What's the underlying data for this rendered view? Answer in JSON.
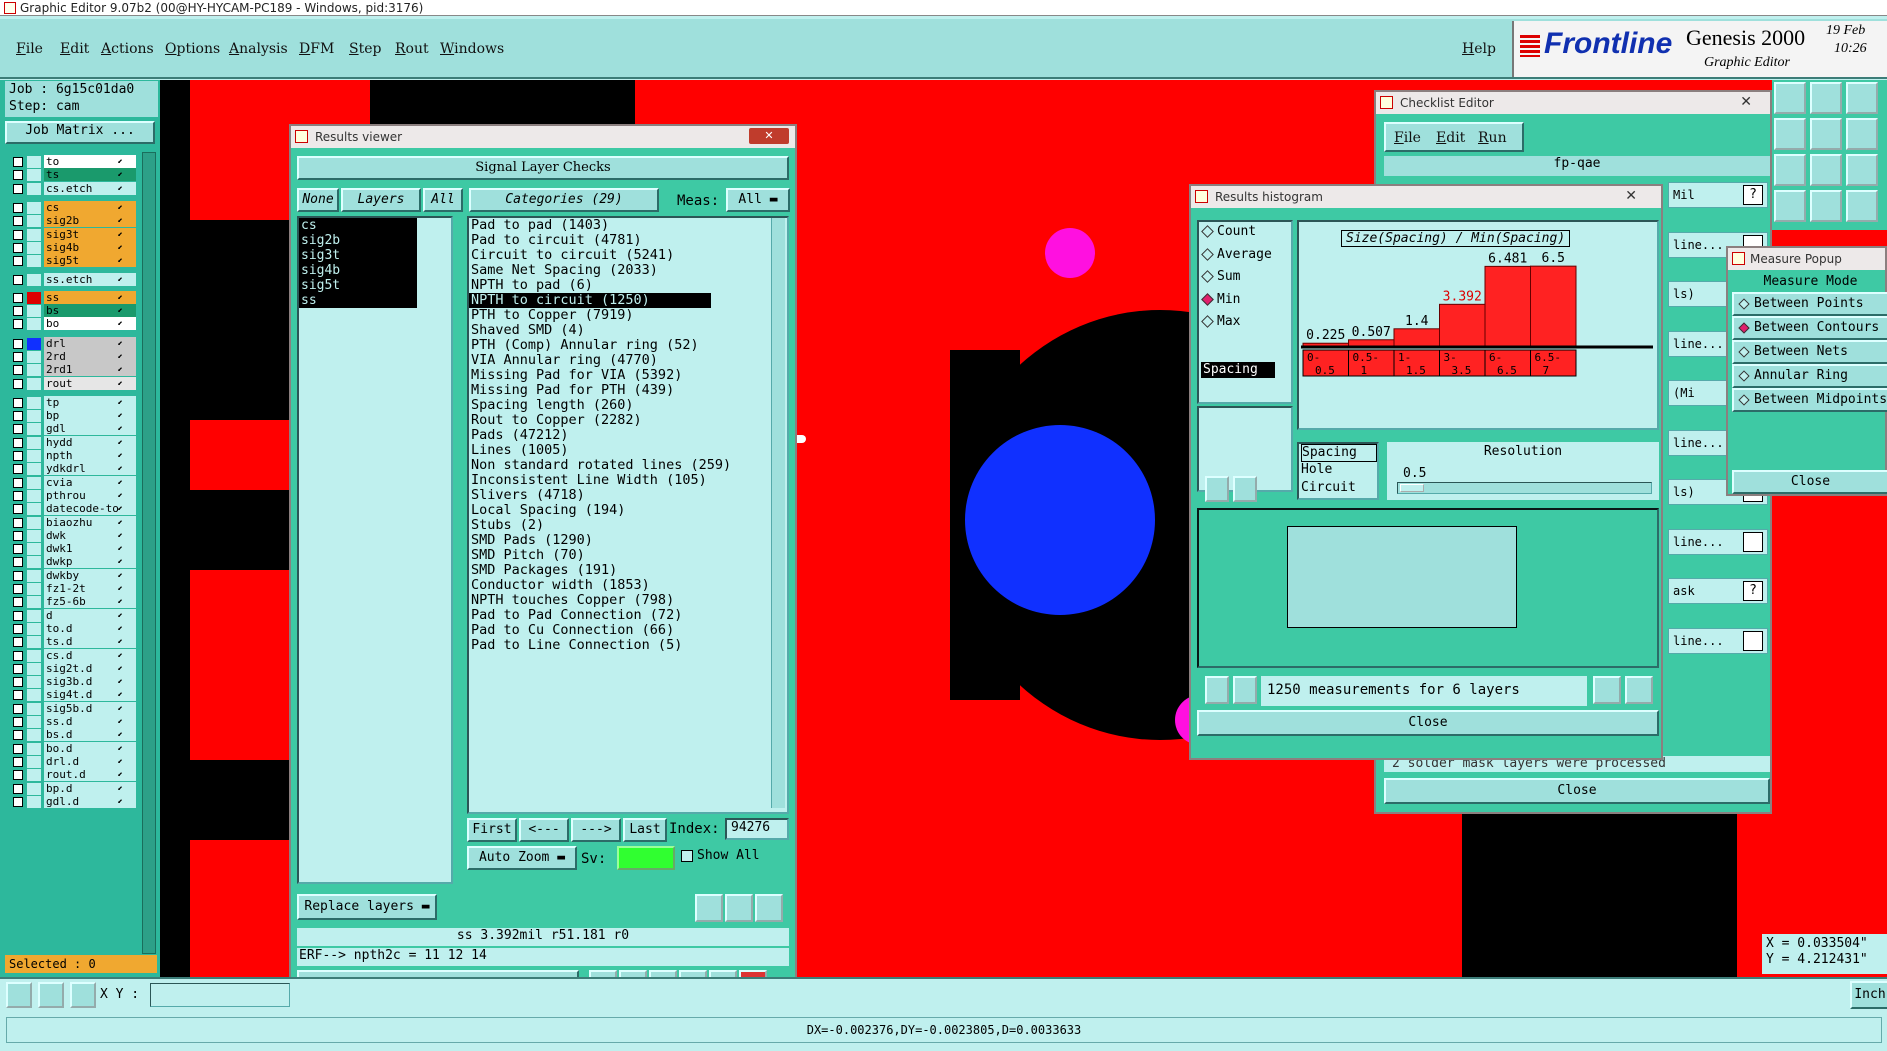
{
  "window_title": "Graphic Editor 9.07b2 (00@HY-HYCAM-PC189 - Windows, pid:3176)",
  "menu": [
    "File",
    "Edit",
    "Actions",
    "Options",
    "Analysis",
    "DFM",
    "Step",
    "Rout",
    "Windows"
  ],
  "help": "Help",
  "brand": {
    "logo": "Frontline",
    "product": "Genesis 2000",
    "subtitle": "Graphic Editor",
    "date": "19 Feb",
    "time": "10:26"
  },
  "job": {
    "job": "Job : 6g15c01da0",
    "step": "Step: cam",
    "matrix_button": "Job Matrix ..."
  },
  "layers": [
    {
      "name": "to",
      "color": "#ffffff"
    },
    {
      "name": "ts",
      "color": "#1a9a6c"
    },
    {
      "name": "cs.etch",
      "color": "#bff0ee"
    },
    {
      "name": "cs",
      "color": "#f0a830"
    },
    {
      "name": "sig2b",
      "color": "#f0a830"
    },
    {
      "name": "sig3t",
      "color": "#f0a830"
    },
    {
      "name": "sig4b",
      "color": "#f0a830"
    },
    {
      "name": "sig5t",
      "color": "#f0a830"
    },
    {
      "name": "ss.etch",
      "color": "#bff0ee"
    },
    {
      "name": "ss",
      "color": "#f0a830"
    },
    {
      "name": "bs",
      "color": "#1a9a6c"
    },
    {
      "name": "bo",
      "color": "#ffffff"
    },
    {
      "name": "drl",
      "color": "#c8c8c8"
    },
    {
      "name": "2rd",
      "color": "#c8c8c8"
    },
    {
      "name": "2rd1",
      "color": "#c8c8c8"
    },
    {
      "name": "rout",
      "color": "#e6e6e6"
    },
    {
      "name": "tp",
      "color": "#bff0ee"
    },
    {
      "name": "bp",
      "color": "#bff0ee"
    },
    {
      "name": "gdl",
      "color": "#bff0ee"
    },
    {
      "name": "hydd",
      "color": "#bff0ee"
    },
    {
      "name": "npth",
      "color": "#bff0ee"
    },
    {
      "name": "ydkdrl",
      "color": "#bff0ee"
    },
    {
      "name": "cvia",
      "color": "#bff0ee"
    },
    {
      "name": "pthrou",
      "color": "#bff0ee"
    },
    {
      "name": "datecode-to",
      "color": "#bff0ee"
    },
    {
      "name": "biaozhu",
      "color": "#bff0ee"
    },
    {
      "name": "dwk",
      "color": "#bff0ee"
    },
    {
      "name": "dwk1",
      "color": "#bff0ee"
    },
    {
      "name": "dwkp",
      "color": "#bff0ee"
    },
    {
      "name": "dwkby",
      "color": "#bff0ee"
    },
    {
      "name": "fz1-2t",
      "color": "#bff0ee"
    },
    {
      "name": "fz5-6b",
      "color": "#bff0ee"
    },
    {
      "name": "d",
      "color": "#bff0ee"
    },
    {
      "name": "to.d",
      "color": "#bff0ee"
    },
    {
      "name": "ts.d",
      "color": "#bff0ee"
    },
    {
      "name": "cs.d",
      "color": "#bff0ee"
    },
    {
      "name": "sig2t.d",
      "color": "#bff0ee"
    },
    {
      "name": "sig3b.d",
      "color": "#bff0ee"
    },
    {
      "name": "sig4t.d",
      "color": "#bff0ee"
    },
    {
      "name": "sig5b.d",
      "color": "#bff0ee"
    },
    {
      "name": "ss.d",
      "color": "#bff0ee"
    },
    {
      "name": "bs.d",
      "color": "#bff0ee"
    },
    {
      "name": "bo.d",
      "color": "#bff0ee"
    },
    {
      "name": "drl.d",
      "color": "#bff0ee"
    },
    {
      "name": "rout.d",
      "color": "#bff0ee"
    },
    {
      "name": "bp.d",
      "color": "#bff0ee"
    },
    {
      "name": "gdl.d",
      "color": "#bff0ee"
    }
  ],
  "selected": "Selected : 0",
  "results_viewer": {
    "title": "Results viewer",
    "header": "Signal Layer Checks",
    "none": "None",
    "layers_tab": "Layers",
    "all": "All",
    "categories_label": "Categories (29)",
    "meas_label": "Meas:",
    "meas_value": "All",
    "layer_list": [
      "cs",
      "sig2b",
      "sig3t",
      "sig4b",
      "sig5t",
      "ss"
    ],
    "categories": [
      "Pad to pad (1403)",
      "Pad to circuit (4781)",
      "Circuit to circuit (5241)",
      "Same Net Spacing (2033)",
      "NPTH to pad (6)",
      "NPTH to circuit (1250)",
      "PTH to Copper (7919)",
      "Shaved SMD (4)",
      "PTH (Comp) Annular ring (52)",
      "VIA Annular ring (4770)",
      "Missing Pad for VIA (5392)",
      "Missing Pad for PTH (439)",
      "Spacing length (260)",
      "Rout to Copper (2282)",
      "Pads (47212)",
      "Lines (1005)",
      "Non standard rotated lines (259)",
      "Inconsistent Line Width (105)",
      "Slivers (4718)",
      "Local Spacing (194)",
      "Stubs (2)",
      "SMD Pads (1290)",
      "SMD Pitch (70)",
      "SMD Packages (191)",
      "Conductor width (1853)",
      "NPTH touches Copper (798)",
      "Pad to Pad Connection (72)",
      "Pad to Cu Connection (66)",
      "Pad to Line Connection (5)"
    ],
    "nav": {
      "first": "First",
      "prev": "<---",
      "next": "--->",
      "last": "Last",
      "index_label": "Index:",
      "index_value": "94276"
    },
    "auto_zoom": "Auto Zoom",
    "sv": "Sv:",
    "show_all": "Show All",
    "replace_layers": "Replace layers",
    "info": "ss 3.392mil  r51.181  r0",
    "erf": "ERF--> npth2c = 11 12 14",
    "close": "Close"
  },
  "histogram": {
    "title": "Results histogram",
    "stats": [
      "Count",
      "Average",
      "Sum",
      "Min",
      "Max"
    ],
    "selected_stat": "Min",
    "chart_title": "Size(Spacing) / Min(Spacing)",
    "bins": [
      "0-0.5",
      "0.5-1",
      "1-1.5",
      "3-3.5",
      "6-6.5",
      "6.5-7"
    ],
    "values": [
      0.225,
      0.507,
      1.4,
      3.392,
      6.481,
      6.5
    ],
    "value_labels": [
      "0.225",
      "0.507",
      "1.4",
      "3.392",
      "6.481",
      "6.5"
    ],
    "list_top": "Spacing",
    "types": [
      "Spacing",
      "Hole",
      "Circuit"
    ],
    "resolution_label": "Resolution",
    "resolution_value": "0.5",
    "summary": "1250 measurements for 6 layers",
    "close": "Close"
  },
  "checklist": {
    "title": "Checklist Editor",
    "menu": [
      "File",
      "Edit",
      "Run"
    ],
    "name": "fp-qae",
    "row_texts": [
      "Mil",
      "line...",
      "ls)",
      "line...",
      "(Mi",
      "line...",
      "ls)",
      "line...",
      "ask",
      "line..."
    ],
    "message": "2 solder mask layers were processed",
    "close": "Close"
  },
  "measure": {
    "title": "Measure Popup",
    "mode": "Measure Mode",
    "options": [
      "Between Points",
      "Between Contours",
      "Between Nets",
      "Annular Ring",
      "Between Midpoints"
    ],
    "selected": "Between Contours",
    "close": "Close"
  },
  "coords": {
    "x": "X = 0.033504\"",
    "y": "Y = 4.212431\""
  },
  "xy_label": "X Y :",
  "units": "Inch",
  "status": "DX=-0.002376,DY=-0.0023805,D=0.0033633",
  "colors": {
    "canvas": "#ff0000",
    "panel": "#3ec9a4",
    "light": "#bff0ee",
    "highlight": "#000000"
  }
}
